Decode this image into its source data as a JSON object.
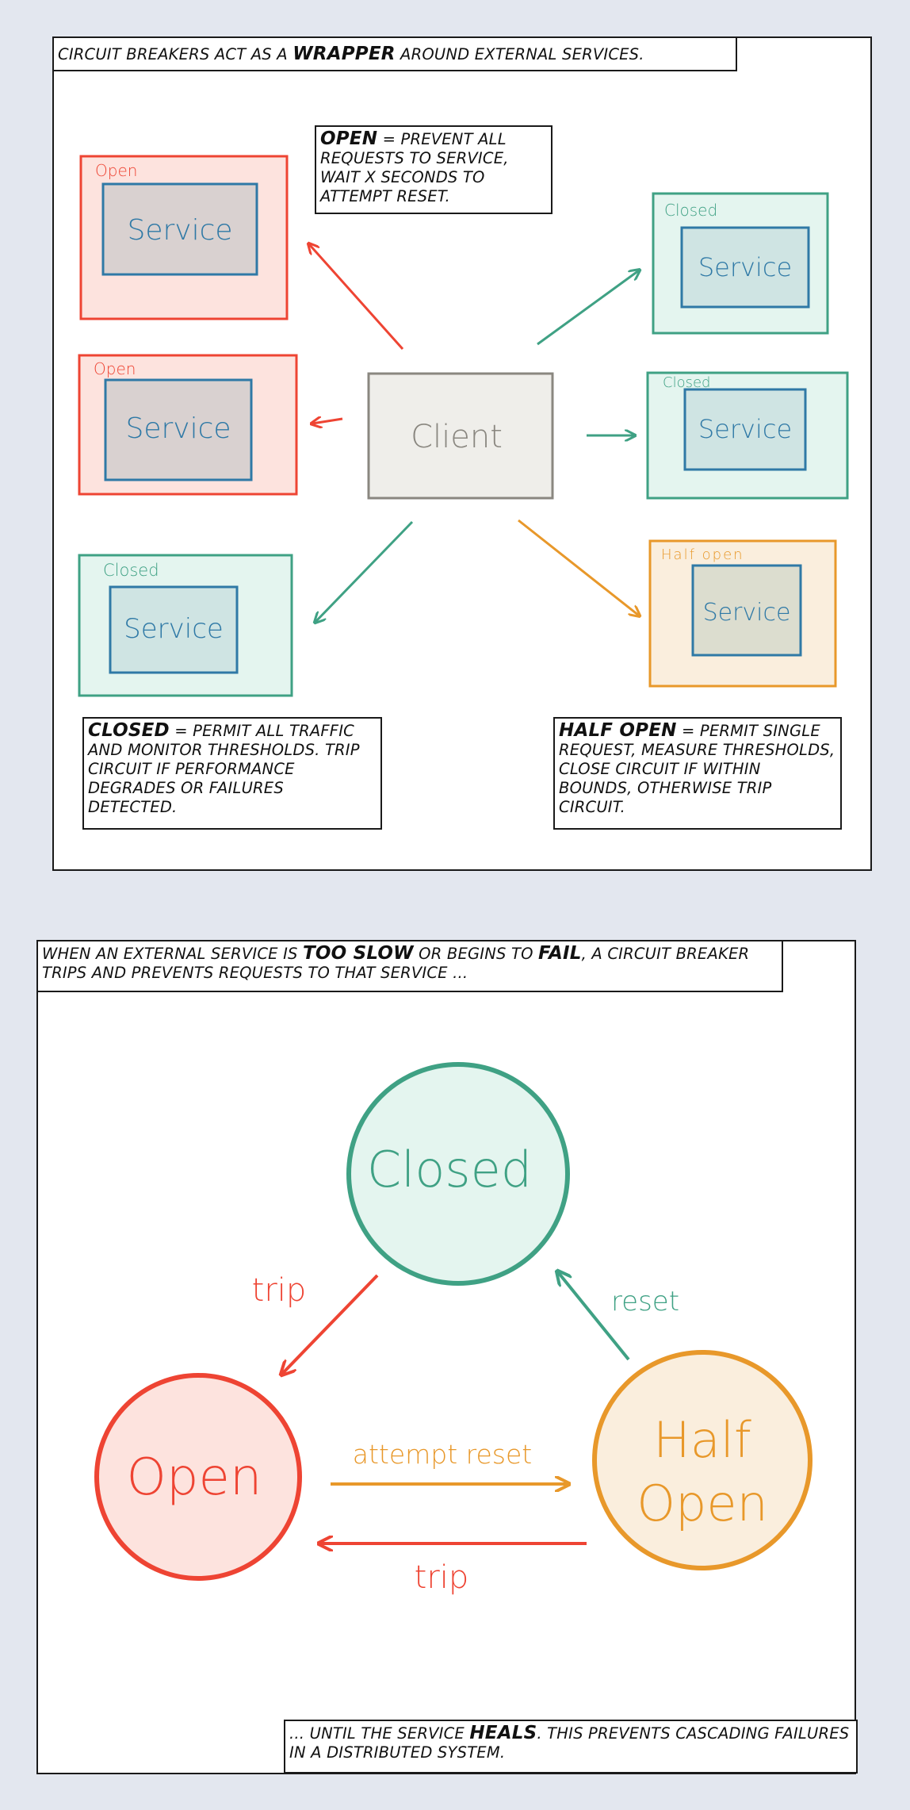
{
  "panel1": {
    "title_parts": [
      "Circuit breakers act as a ",
      "wrapper",
      " around external services."
    ],
    "open_note": {
      "term": "Open",
      "rest": " = prevent all requests to service, wait X seconds to attempt reset."
    },
    "closed_note": {
      "term": "Closed",
      "rest": " = permit all traffic and monitor thresholds. Trip circuit if performance degrades or failures detected."
    },
    "half_note": {
      "term": "Half open",
      "rest": " = permit single request, measure thresholds, close circuit if within bounds, otherwise trip circuit."
    },
    "client_label": "Client",
    "service_label": "Service",
    "boxes": [
      {
        "state": "Open"
      },
      {
        "state": "Open"
      },
      {
        "state": "Closed"
      },
      {
        "state": "Closed"
      },
      {
        "state": "Closed"
      },
      {
        "state": "Half open"
      }
    ]
  },
  "panel2": {
    "title_parts": [
      "When an external service is ",
      "too slow",
      " or begins to ",
      "fail",
      ", a circuit breaker trips and prevents requests to that service ..."
    ],
    "bottom_parts": [
      "... until the service ",
      "heals",
      ". This prevents cascading failures in a distributed system."
    ],
    "states": {
      "closed": "Closed",
      "open": "Open",
      "half_line1": "Half",
      "half_line2": "Open"
    },
    "transitions": {
      "trip_closed_open": "trip",
      "reset": "reset",
      "attempt_reset": "attempt reset",
      "trip_half_open": "trip"
    }
  },
  "colors": {
    "open_stroke": "#ee4433",
    "open_fill": "#fde3de",
    "closed_stroke": "#3fa184",
    "closed_fill": "#e4f5ef",
    "half_stroke": "#e8982a",
    "half_fill": "#faeedd",
    "service_stroke": "#2f79a6",
    "client_stroke": "#8a8780",
    "client_fill": "#efeeea",
    "background": "#e3e7ef"
  }
}
